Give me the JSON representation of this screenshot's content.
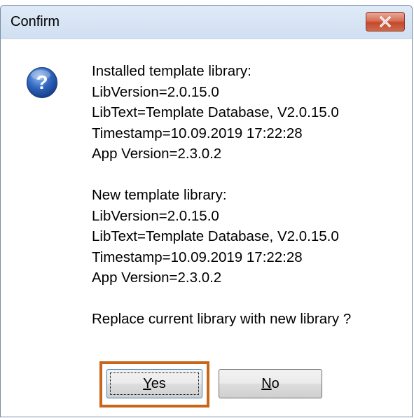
{
  "window": {
    "title": "Confirm",
    "close_icon": "close-icon"
  },
  "dialog": {
    "icon": "question-icon",
    "installed": {
      "heading": "Installed template library:",
      "lib_version": "LibVersion=2.0.15.0",
      "lib_text": "LibText=Template Database, V2.0.15.0",
      "timestamp": "Timestamp=10.09.2019 17:22:28",
      "app_version": "App Version=2.3.0.2"
    },
    "new": {
      "heading": "New template library:",
      "lib_version": "LibVersion=2.0.15.0",
      "lib_text": "LibText=Template Database, V2.0.15.0",
      "timestamp": "Timestamp=10.09.2019 17:22:28",
      "app_version": "App Version=2.3.0.2"
    },
    "question": "Replace current library with new library ?"
  },
  "buttons": {
    "yes": {
      "mnemonic": "Y",
      "rest": "es"
    },
    "no": {
      "mnemonic": "N",
      "rest": "o"
    }
  },
  "colors": {
    "focus_highlight": "#c8661a",
    "close_button": "#c44a2c",
    "titlebar": "#d0dff1"
  }
}
